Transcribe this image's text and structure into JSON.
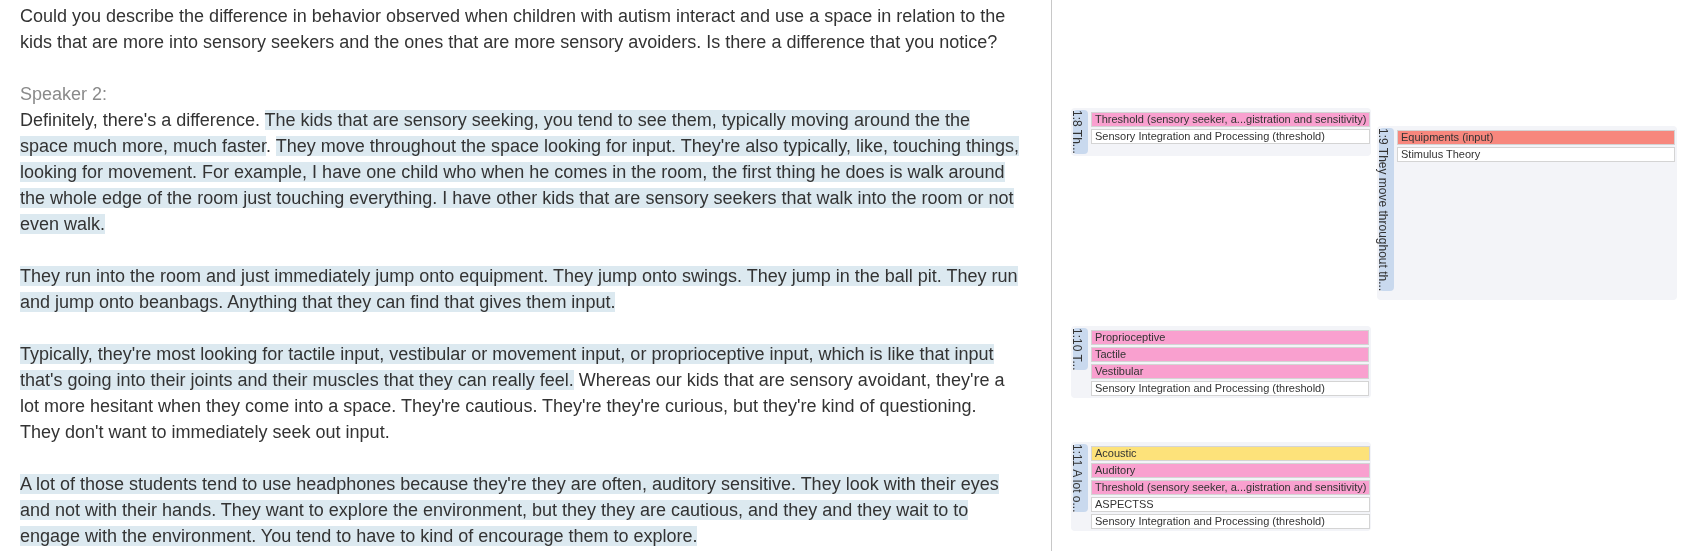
{
  "transcript": {
    "blocks": [
      {
        "kind": "paragraph",
        "segments": [
          {
            "text": "Could you describe the difference in behavior observed when children with autism interact and use a space in relation to the kids that are more into sensory seekers and the ones that are more sensory avoiders. Is there a difference that you notice?",
            "highlighted": false
          }
        ]
      },
      {
        "kind": "speaker",
        "text": "Speaker 2:"
      },
      {
        "kind": "paragraph",
        "segments": [
          {
            "text": "Definitely, there's a difference. ",
            "highlighted": false
          },
          {
            "text": "The kids that are sensory seeking, you tend to see them, typically moving around the the space much more, much faster",
            "highlighted": true
          },
          {
            "text": ". ",
            "highlighted": false
          },
          {
            "text": "They move throughout the space looking for input. They're also typically, like, touching things, looking for movement. For example, I have one child who when he comes in the room, the first thing he does is walk around the whole edge of the room just touching everything. I have other kids that are sensory seekers that walk into the room or not even walk.",
            "highlighted": true
          }
        ]
      },
      {
        "kind": "paragraph",
        "segments": [
          {
            "text": "They run into the room and just immediately jump onto equipment. They jump onto swings. They jump in the ball pit. They run and jump onto beanbags. Anything that they can find that gives them input.",
            "highlighted": true
          }
        ]
      },
      {
        "kind": "paragraph",
        "segments": [
          {
            "text": "Typically, they're most looking for tactile input, vestibular or movement input, or proprioceptive input, which is like that input that's going into their joints and their muscles that they can really feel.",
            "highlighted": true
          },
          {
            "text": " Whereas our kids that are sensory avoidant, they're a lot more hesitant when they come into a space. They're cautious. They're they're curious, but they're kind of questioning. They don't want to immediately seek out input.",
            "highlighted": false
          }
        ]
      },
      {
        "kind": "paragraph",
        "segments": [
          {
            "text": "A lot of those students tend to use headphones because they're they are often, auditory sensitive. They look with their eyes and not with their hands. They want to explore the environment, but they they are cautious, and they and they wait to to engage with the environment. You tend to have to kind of encourage them to explore.",
            "highlighted": true
          }
        ]
      }
    ]
  },
  "code_columns": [
    {
      "groups": [
        {
          "label": "1:8 Th...",
          "codes": [
            {
              "text": "Threshold (sensory seeker, a...gistration and sensitivity)",
              "color": "#f9a0cf"
            },
            {
              "text": "Sensory Integration and Processing (threshold)",
              "color": "#ffffff"
            }
          ]
        },
        {
          "label": "1:10 T...",
          "codes": [
            {
              "text": "Proprioceptive",
              "color": "#f9a0cf"
            },
            {
              "text": "Tactile",
              "color": "#f9a0cf"
            },
            {
              "text": "Vestibular",
              "color": "#f9a0cf"
            },
            {
              "text": "Sensory Integration and Processing (threshold)",
              "color": "#ffffff"
            }
          ]
        },
        {
          "label": "1:11 A lot o...",
          "codes": [
            {
              "text": "Acoustic",
              "color": "#fde27a"
            },
            {
              "text": "Auditory",
              "color": "#f9a0cf"
            },
            {
              "text": "Threshold (sensory seeker, a...gistration and sensitivity)",
              "color": "#f9a0cf"
            },
            {
              "text": "ASPECTSS",
              "color": "#ffffff"
            },
            {
              "text": "Sensory Integration and Processing (threshold)",
              "color": "#ffffff"
            }
          ]
        }
      ]
    },
    {
      "groups": [
        {
          "label": "1:9 They move throughout th...",
          "codes": [
            {
              "text": "Equipments (input)",
              "color": "#f7877d"
            },
            {
              "text": "Stimulus Theory",
              "color": "#ffffff"
            }
          ]
        }
      ]
    }
  ]
}
